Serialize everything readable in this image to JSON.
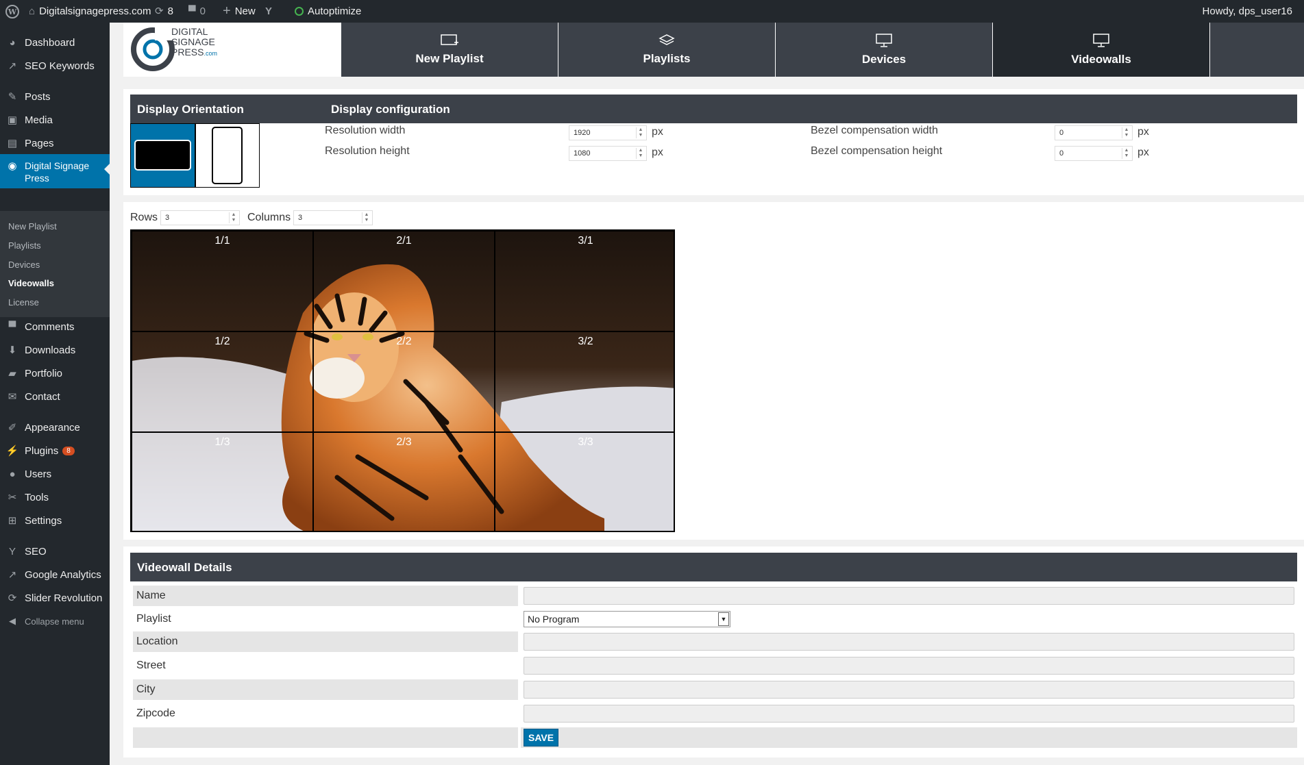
{
  "adminbar": {
    "site": "Digitalsignagepress.com",
    "updates": "8",
    "comments": "0",
    "new_label": "New",
    "autoptimize": "Autoptimize",
    "howdy": "Howdy, dps_user16"
  },
  "sidebar": {
    "items": [
      {
        "label": "Dashboard",
        "icon": "dashboard-icon"
      },
      {
        "label": "SEO Keywords",
        "icon": "chart-icon"
      },
      {
        "label": "Posts",
        "icon": "pin-icon"
      },
      {
        "label": "Media",
        "icon": "media-icon"
      },
      {
        "label": "Pages",
        "icon": "pages-icon"
      },
      {
        "label": "Digital Signage Press",
        "icon": "dsp-icon"
      },
      {
        "label": "Comments",
        "icon": "comment-icon"
      },
      {
        "label": "Downloads",
        "icon": "download-icon"
      },
      {
        "label": "Portfolio",
        "icon": "folder-icon"
      },
      {
        "label": "Contact",
        "icon": "mail-icon"
      },
      {
        "label": "Appearance",
        "icon": "brush-icon"
      },
      {
        "label": "Plugins",
        "icon": "plug-icon",
        "badge": "8"
      },
      {
        "label": "Users",
        "icon": "user-icon"
      },
      {
        "label": "Tools",
        "icon": "wrench-icon"
      },
      {
        "label": "Settings",
        "icon": "settings-icon"
      },
      {
        "label": "SEO",
        "icon": "yoast-icon"
      },
      {
        "label": "Google Analytics",
        "icon": "chart-icon"
      },
      {
        "label": "Slider Revolution",
        "icon": "refresh-icon"
      },
      {
        "label": "Collapse menu",
        "icon": "collapse-icon"
      }
    ],
    "submenu": [
      "New Playlist",
      "Playlists",
      "Devices",
      "Videowalls",
      "License"
    ]
  },
  "logo": {
    "line1": "Digital",
    "line2": "Signage",
    "line3": "Press",
    "suffix": ".com"
  },
  "nav": {
    "tabs": [
      "New Playlist",
      "Playlists",
      "Devices",
      "Videowalls"
    ]
  },
  "config": {
    "orientation_title": "Display Orientation",
    "config_title": "Display configuration",
    "res_width_label": "Resolution width",
    "res_width": "1920",
    "res_height_label": "Resolution height",
    "res_height": "1080",
    "bezel_width_label": "Bezel compensation width",
    "bezel_width": "0",
    "bezel_height_label": "Bezel compensation height",
    "bezel_height": "0",
    "unit": "px"
  },
  "grid": {
    "rows_label": "Rows",
    "rows": "3",
    "cols_label": "Columns",
    "cols": "3",
    "cells": [
      "1/1",
      "2/1",
      "3/1",
      "1/2",
      "2/2",
      "3/2",
      "1/3",
      "2/3",
      "3/3"
    ]
  },
  "details": {
    "title": "Videowall Details",
    "fields": [
      "Name",
      "Playlist",
      "Location",
      "Street",
      "City",
      "Zipcode"
    ],
    "playlist_value": "No Program",
    "save": "SAVE"
  },
  "colors": {
    "accent": "#0073aa",
    "dark": "#23282d",
    "header": "#3c4149"
  }
}
